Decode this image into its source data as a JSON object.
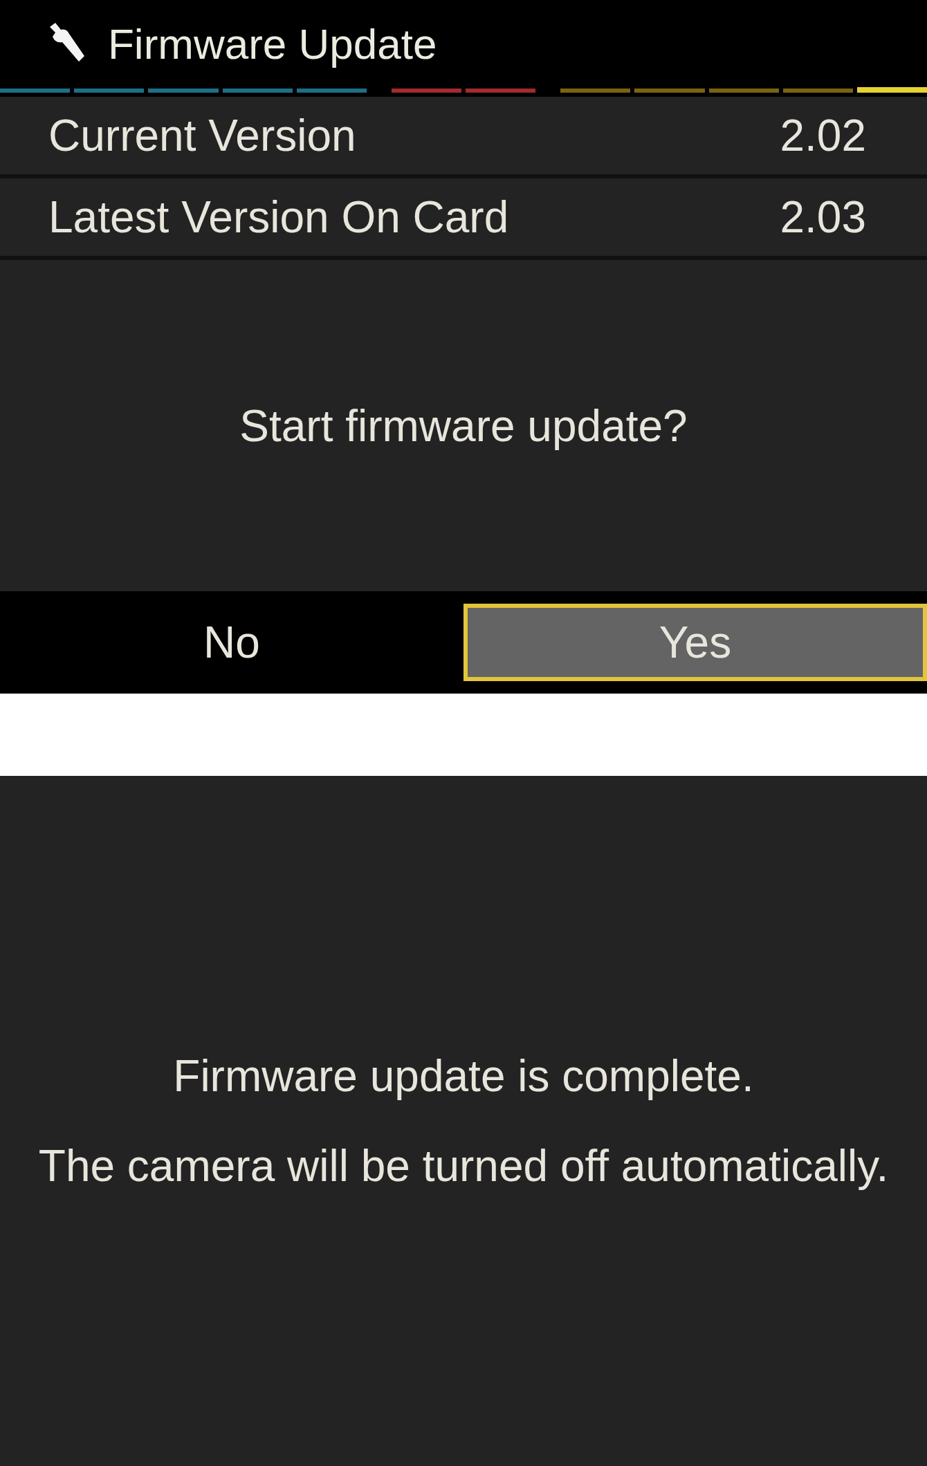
{
  "screens": [
    {
      "kind": "confirm",
      "title": "Firmware Update",
      "menu_tabs": [
        {
          "color": "#1e6f86",
          "selected": false
        },
        {
          "color": "#1e6f86",
          "selected": false
        },
        {
          "color": "#1e6f86",
          "selected": false
        },
        {
          "color": "#1e6f86",
          "selected": false
        },
        {
          "color": "#1e6f86",
          "selected": false
        },
        {
          "color": "#a32a2e",
          "selected": false
        },
        {
          "color": "#a32a2e",
          "selected": false
        },
        {
          "color": "#7a6410",
          "selected": false
        },
        {
          "color": "#7a6410",
          "selected": false
        },
        {
          "color": "#7a6410",
          "selected": false
        },
        {
          "color": "#7a6410",
          "selected": false
        },
        {
          "color": "#e6d232",
          "selected": true
        }
      ],
      "rows": [
        {
          "label": "Current Version",
          "value": "2.02"
        },
        {
          "label": "Latest Version On Card",
          "value": "2.03"
        }
      ],
      "messages": [
        "Start firmware update?"
      ],
      "buttons": [
        {
          "label": "No",
          "selected": false
        },
        {
          "label": "Yes",
          "selected": true
        }
      ]
    },
    {
      "kind": "message",
      "messages": [
        "Firmware update is complete.",
        "The camera will be turned off automatically."
      ]
    }
  ]
}
